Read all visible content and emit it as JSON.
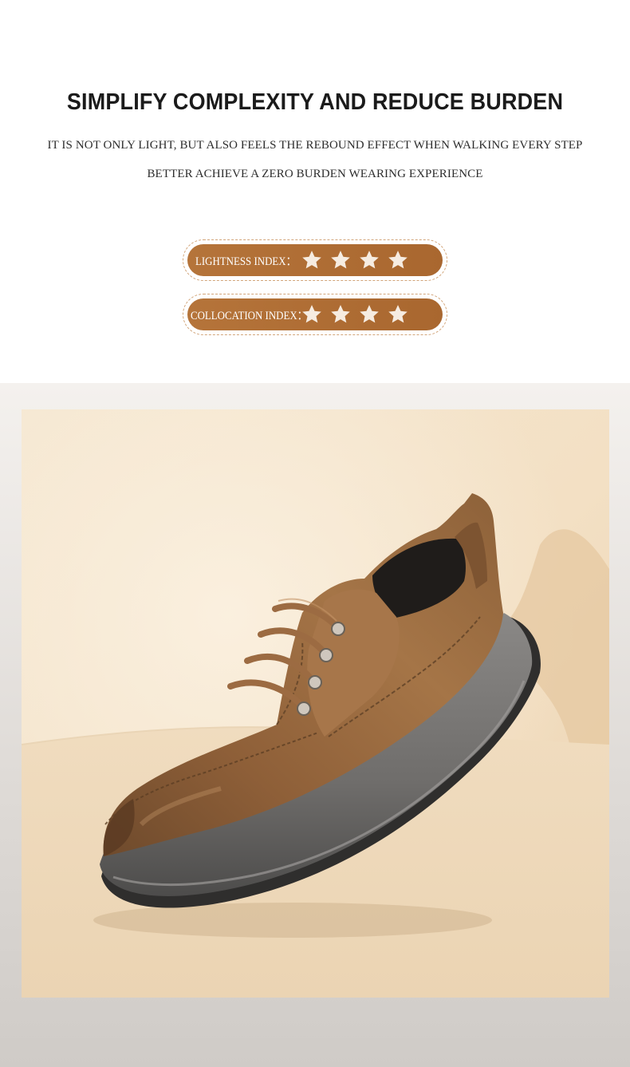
{
  "header": {
    "title": "SIMPLIFY COMPLEXITY AND REDUCE BURDEN",
    "line1": "IT IS NOT ONLY LIGHT, BUT ALSO FEELS THE REBOUND EFFECT WHEN WALKING EVERY STEP",
    "line2": "BETTER ACHIEVE A ZERO BURDEN WEARING EXPERIENCE"
  },
  "ratings": [
    {
      "label": "LIGHTNESS INDEX：",
      "stars": 4
    },
    {
      "label": "COLLOCATION INDEX：",
      "stars": 4
    }
  ],
  "colors": {
    "pill": "#b06e35",
    "star": "#f6ece1",
    "leather": "#96643a",
    "sole": "#6e6d6c"
  },
  "icons": {
    "rating_star": "star-icon"
  }
}
